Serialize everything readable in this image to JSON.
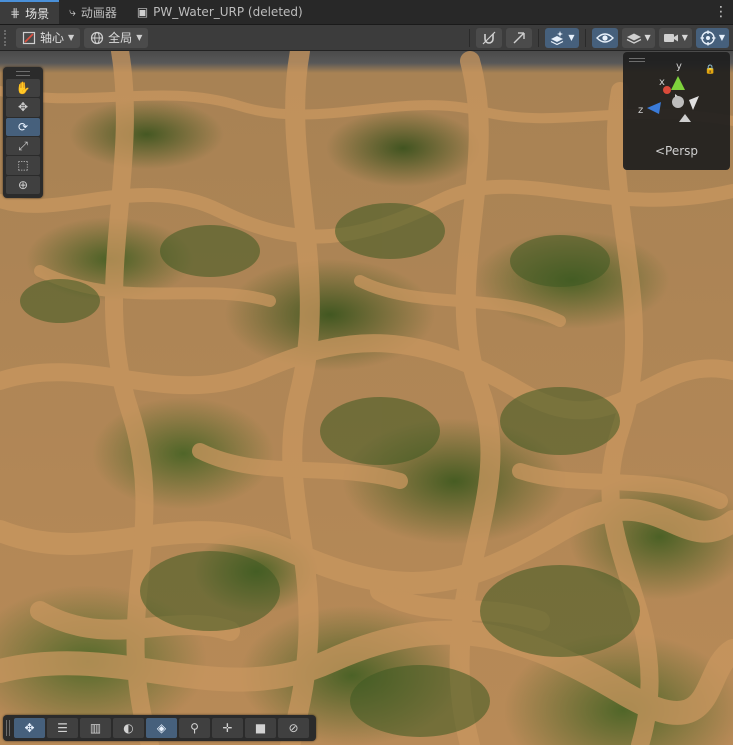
{
  "tabs": [
    {
      "label": "场景",
      "icon": "grid-icon",
      "active": true
    },
    {
      "label": "动画器",
      "icon": "animator-icon",
      "active": false
    },
    {
      "label": "PW_Water_URP (deleted)",
      "icon": "prefab-icon",
      "active": false
    }
  ],
  "tab_menu_glyph": "⋮",
  "toolbar": {
    "pivot_label": "轴心",
    "space_label": "全局"
  },
  "gizmo": {
    "projection_label": "Persp",
    "axes": {
      "x": "x",
      "y": "y",
      "z": "z"
    },
    "colors": {
      "x": "#d94a3a",
      "y": "#7ed23c",
      "z": "#3a7bd9"
    }
  },
  "colors": {
    "accent": "#46607c",
    "active_tab_line": "#4a90d9",
    "grass": "#4a6a2a",
    "dirt": "#b88a57"
  }
}
